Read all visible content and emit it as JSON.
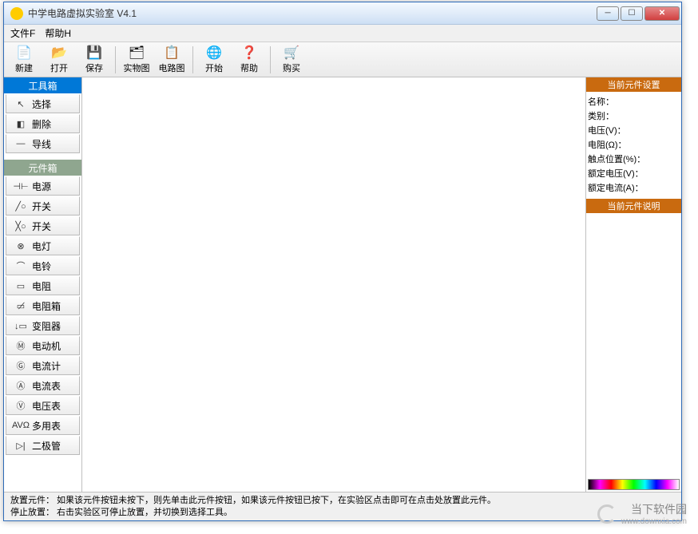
{
  "title": "中学电路虚拟实验室 V4.1",
  "menu": {
    "file": "文件F",
    "help": "帮助H"
  },
  "toolbar": [
    {
      "icon": "📄",
      "label": "新建",
      "name": "new-button"
    },
    {
      "icon": "📂",
      "label": "打开",
      "name": "open-button"
    },
    {
      "icon": "💾",
      "label": "保存",
      "name": "save-button"
    },
    {
      "sep": true
    },
    {
      "icon": "🗂",
      "label": "实物图",
      "name": "real-view-button"
    },
    {
      "icon": "📋",
      "label": "电路图",
      "name": "schematic-button"
    },
    {
      "sep": true
    },
    {
      "icon": "🌐",
      "label": "开始",
      "name": "start-button"
    },
    {
      "icon": "❓",
      "label": "帮助",
      "name": "help-button"
    },
    {
      "sep": true
    },
    {
      "icon": "🛒",
      "label": "购买",
      "name": "buy-button"
    }
  ],
  "toolbox": {
    "header": "工具箱",
    "items": [
      {
        "icon": "↖",
        "label": "选择",
        "name": "select-tool"
      },
      {
        "icon": "◧",
        "label": "删除",
        "name": "delete-tool"
      },
      {
        "icon": "—",
        "label": "导线",
        "name": "wire-tool"
      }
    ]
  },
  "compbox": {
    "header": "元件箱",
    "items": [
      {
        "icon": "⊣⊢",
        "label": "电源",
        "name": "comp-power"
      },
      {
        "icon": "╱○",
        "label": "开关",
        "name": "comp-switch1"
      },
      {
        "icon": "╳○",
        "label": "开关",
        "name": "comp-switch2"
      },
      {
        "icon": "⊗",
        "label": "电灯",
        "name": "comp-lamp"
      },
      {
        "icon": "⌒",
        "label": "电铃",
        "name": "comp-bell"
      },
      {
        "icon": "▭",
        "label": "电阻",
        "name": "comp-resistor"
      },
      {
        "icon": "▭̸",
        "label": "电阻箱",
        "name": "comp-resistor-box"
      },
      {
        "icon": "↓▭",
        "label": "变阻器",
        "name": "comp-rheostat"
      },
      {
        "icon": "Ⓜ",
        "label": "电动机",
        "name": "comp-motor"
      },
      {
        "icon": "Ⓖ",
        "label": "电流计",
        "name": "comp-galvanometer"
      },
      {
        "icon": "Ⓐ",
        "label": "电流表",
        "name": "comp-ammeter"
      },
      {
        "icon": "Ⓥ",
        "label": "电压表",
        "name": "comp-voltmeter"
      },
      {
        "icon": "AVΩ",
        "label": "多用表",
        "name": "comp-multimeter"
      },
      {
        "icon": "▷|",
        "label": "二极管",
        "name": "comp-diode"
      }
    ]
  },
  "props": {
    "header": "当前元件设置",
    "rows": [
      "名称：",
      "类别：",
      "电压(V)：",
      "电阻(Ω)：",
      "触点位置(%)：",
      "额定电压(V)：",
      "额定电流(A)："
    ],
    "desc_header": "当前元件说明"
  },
  "status": {
    "line1": "放置元件：  如果该元件按钮未按下，则先单击此元件按钮，如果该元件按钮已按下，在实验区点击即可在点击处放置此元件。",
    "line2": "停止放置：  右击实验区可停止放置，并切换到选择工具。"
  },
  "watermark": {
    "cn": "当下软件园",
    "url": "www.downxia.com"
  }
}
